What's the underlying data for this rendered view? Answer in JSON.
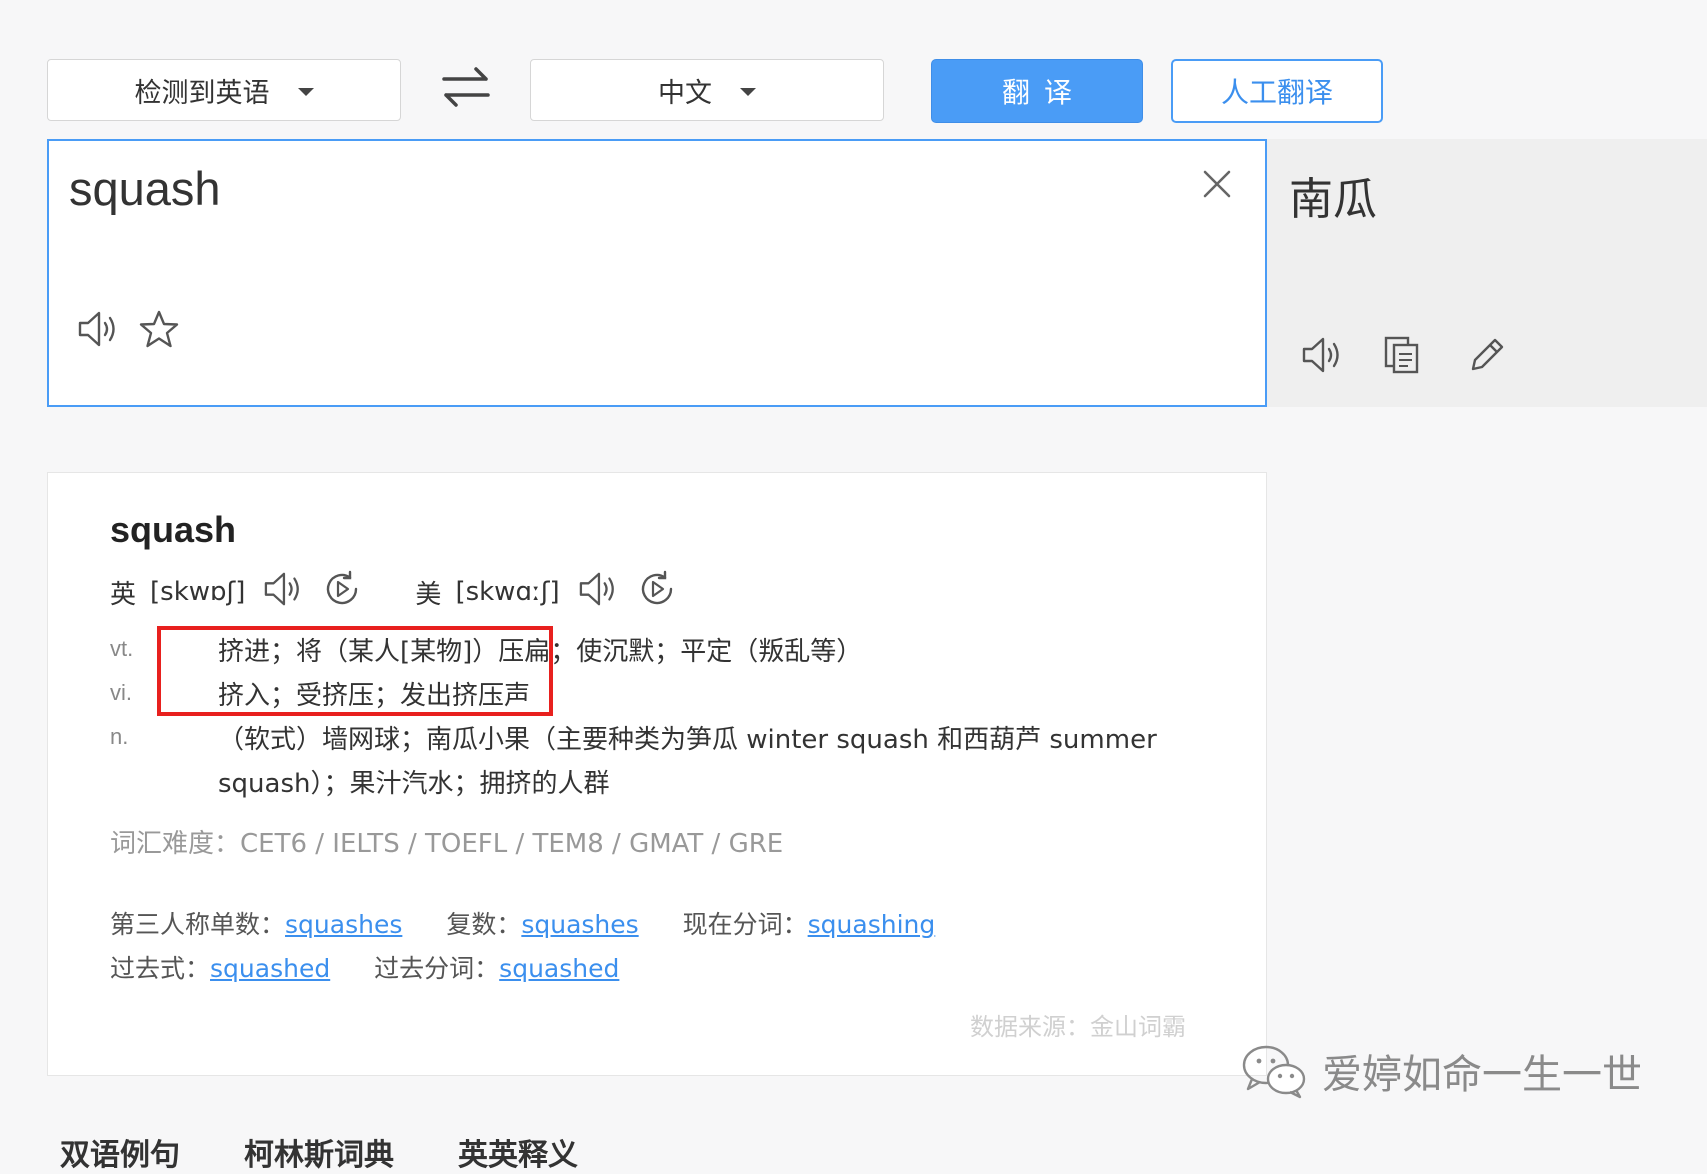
{
  "toolbar": {
    "source_lang": "检测到英语",
    "target_lang": "中文",
    "translate_label": "翻译",
    "human_translate_label": "人工翻译",
    "swap_icon": "swap-arrows-icon",
    "dropdown_icon": "caret-down-icon"
  },
  "input": {
    "text": "squash",
    "icons": [
      "speaker-icon",
      "star-icon",
      "close-icon"
    ]
  },
  "output": {
    "text": "南瓜",
    "icons": [
      "speaker-icon",
      "copy-icon",
      "pencil-icon"
    ]
  },
  "dictionary": {
    "word": "squash",
    "uk_label": "英",
    "uk_ipa": "[skwɒʃ]",
    "us_label": "美",
    "us_ipa": "[skwɑːʃ]",
    "definitions": [
      {
        "pos": "vt.",
        "text": "挤进；将（某人[某物]）压扁；使沉默；平定（叛乱等）"
      },
      {
        "pos": "vi.",
        "text": "挤入；受挤压；发出挤压声"
      },
      {
        "pos": "n.",
        "text": "（软式）墙网球；南瓜小果（主要种类为笋瓜 winter squash 和西葫芦 summer",
        "text2": "squash）；果汁汽水；拥挤的人群"
      }
    ],
    "level_label": "词汇难度：",
    "level_value": "CET6 / IELTS / TOEFL / TEM8 / GMAT / GRE",
    "forms": {
      "third_person_label": "第三人称单数：",
      "third_person": "squashes",
      "plural_label": "复数：",
      "plural": "squashes",
      "present_participle_label": "现在分词：",
      "present_participle": "squashing",
      "past_label": "过去式：",
      "past": "squashed",
      "past_participle_label": "过去分词：",
      "past_participle": "squashed"
    },
    "source": "数据来源：金山词霸"
  },
  "bottom_tabs": [
    "双语例句",
    "柯林斯词典",
    "英英释义"
  ],
  "watermark": {
    "text": "爱婷如命一生一世",
    "icon": "wechat-icon"
  },
  "colors": {
    "accent": "#4a9cf6",
    "highlight_border": "#e8201e",
    "link": "#3b8fee"
  }
}
